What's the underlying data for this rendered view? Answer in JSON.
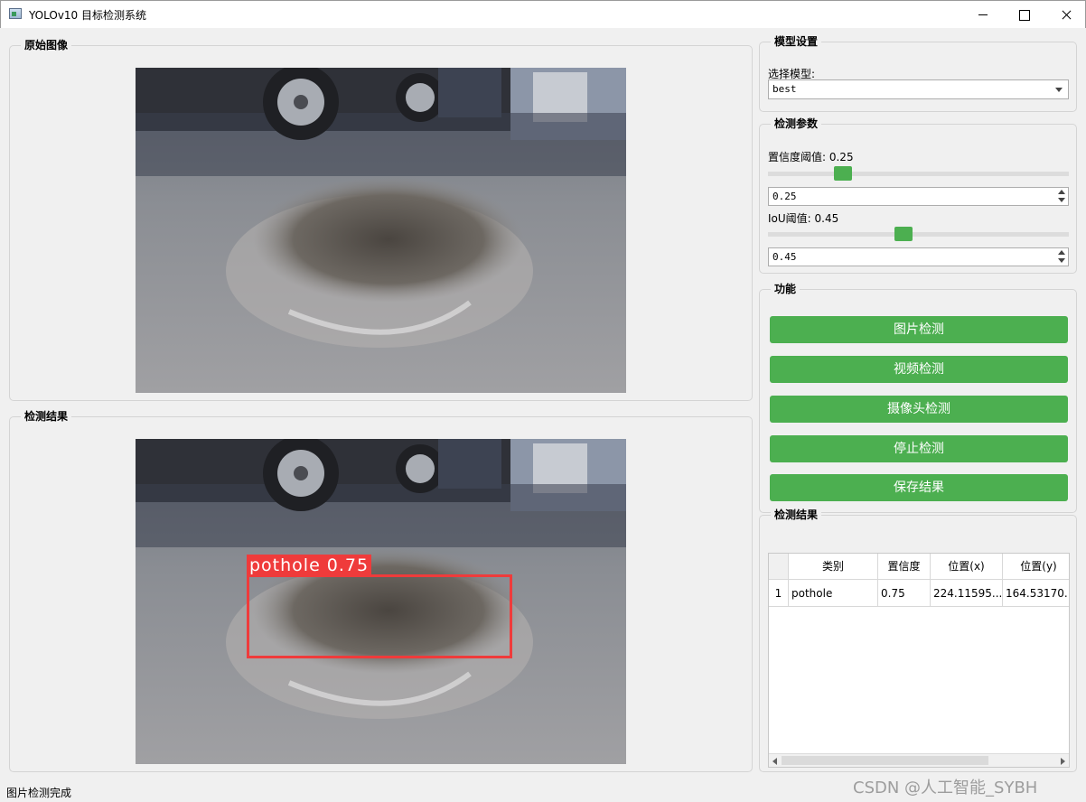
{
  "window": {
    "title": "YOLOv10 目标检测系统"
  },
  "original_panel": {
    "title": "原始图像"
  },
  "result_panel": {
    "title": "检测结果"
  },
  "detection_overlay": {
    "label": "pothole  0.75"
  },
  "model_settings": {
    "title": "模型设置",
    "select_label": "选择模型:",
    "selected_model": "best"
  },
  "detect_params": {
    "title": "检测参数",
    "confidence_label": "置信度阈值: 0.25",
    "confidence_value": "0.25",
    "confidence_level": 0.25,
    "iou_label": "IoU阈值: 0.45",
    "iou_value": "0.45",
    "iou_level": 0.45
  },
  "functions": {
    "title": "功能",
    "buttons": [
      "图片检测",
      "视频检测",
      "摄像头检测",
      "停止检测",
      "保存结果"
    ]
  },
  "results_table": {
    "title": "检测结果",
    "columns": [
      "类别",
      "置信度",
      "位置(x)",
      "位置(y)"
    ],
    "rows": [
      {
        "index": "1",
        "cells": [
          "pothole",
          "0.75",
          "224.11595...",
          "164.53170..."
        ]
      }
    ]
  },
  "status_bar": {
    "text": "图片检测完成"
  },
  "watermark": {
    "text": "CSDN @人工智能_SYBH"
  },
  "colors": {
    "accent_green": "#4caf50",
    "detection_red": "#ef3b3b"
  }
}
